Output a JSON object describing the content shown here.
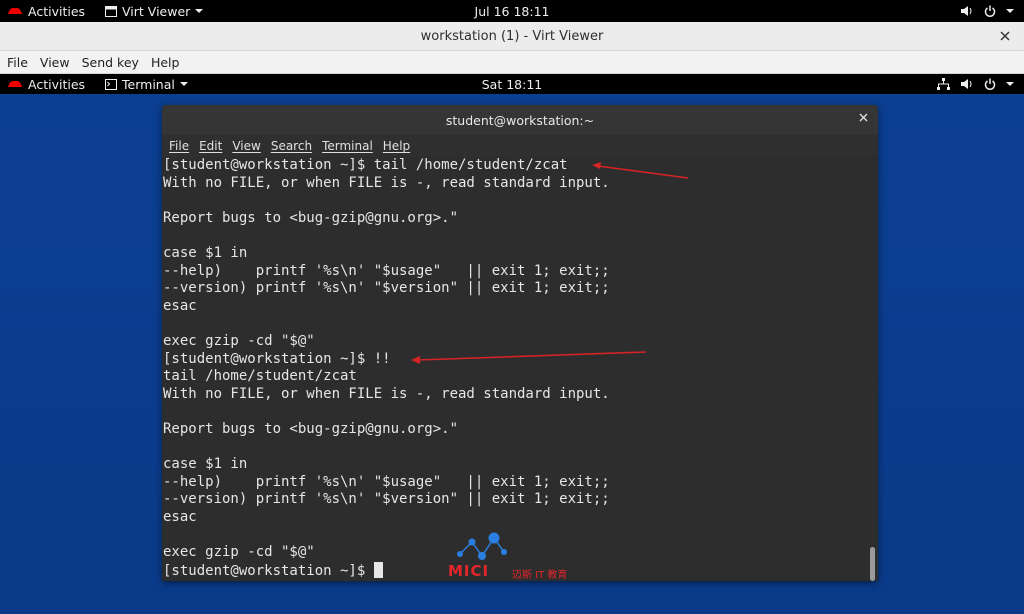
{
  "host_bar": {
    "activities": "Activities",
    "app_name": "Virt Viewer",
    "clock": "Jul 16  18:11"
  },
  "viewer": {
    "title": "workstation (1) - Virt Viewer",
    "menu": [
      "File",
      "View",
      "Send key",
      "Help"
    ]
  },
  "guest_bar": {
    "activities": "Activities",
    "app_name": "Terminal",
    "clock": "Sat 18:11"
  },
  "terminal": {
    "title": "student@workstation:~",
    "menu": [
      "File",
      "Edit",
      "View",
      "Search",
      "Terminal",
      "Help"
    ],
    "lines": [
      "[student@workstation ~]$ tail /home/student/zcat",
      "With no FILE, or when FILE is -, read standard input.",
      "",
      "Report bugs to <bug-gzip@gnu.org>.\"",
      "",
      "case $1 in",
      "--help)    printf '%s\\n' \"$usage\"   || exit 1; exit;;",
      "--version) printf '%s\\n' \"$version\" || exit 1; exit;;",
      "esac",
      "",
      "exec gzip -cd \"$@\"",
      "[student@workstation ~]$ !!",
      "tail /home/student/zcat",
      "With no FILE, or when FILE is -, read standard input.",
      "",
      "Report bugs to <bug-gzip@gnu.org>.\"",
      "",
      "case $1 in",
      "--help)    printf '%s\\n' \"$usage\"   || exit 1; exit;;",
      "--version) printf '%s\\n' \"$version\" || exit 1; exit;;",
      "esac",
      "",
      "exec gzip -cd \"$@\""
    ],
    "prompt": "[student@workstation ~]$ "
  },
  "watermark": {
    "brand": "MICI",
    "sub": "迈斯 IT 教育"
  },
  "colors": {
    "annotation_arrow": "#d42424",
    "terminal_bg": "#2d2d2d",
    "desktop_bg": "#0b3f93"
  }
}
